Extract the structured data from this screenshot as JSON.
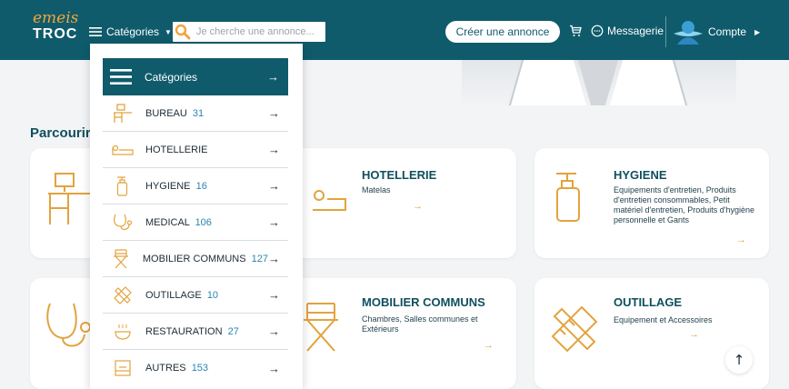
{
  "header": {
    "logo_top": "emeis",
    "logo_bottom": "TROC",
    "categories_label": "Catégories",
    "search_placeholder": "Je cherche une annonce...",
    "create_label": "Créer une annonce",
    "messages_label": "Messagerie",
    "account_label": "Compte"
  },
  "colors": {
    "primary": "#0f5b6b",
    "accent": "#e3a33d",
    "count": "#2a85b0"
  },
  "section_title": "Parcourir",
  "dropdown": {
    "header_label": "Catégories",
    "items": [
      {
        "name": "BUREAU",
        "count": "31",
        "icon": "desk-icon"
      },
      {
        "name": "HOTELLERIE",
        "count": "",
        "icon": "bed-icon"
      },
      {
        "name": "HYGIENE",
        "count": "16",
        "icon": "soap-bottle-icon"
      },
      {
        "name": "MEDICAL",
        "count": "106",
        "icon": "stethoscope-icon"
      },
      {
        "name": "MOBILIER COMMUNS",
        "count": "127",
        "icon": "chair-icon"
      },
      {
        "name": "OUTILLAGE",
        "count": "10",
        "icon": "tools-icon"
      },
      {
        "name": "RESTAURATION",
        "count": "27",
        "icon": "dish-icon"
      },
      {
        "name": "AUTRES",
        "count": "153",
        "icon": "box-icon"
      }
    ]
  },
  "cards": {
    "hotellerie": {
      "title": "HOTELLERIE",
      "desc": "Matelas"
    },
    "hygiene": {
      "title": "HYGIENE",
      "desc": "Equipements d'entretien, Produits d'entretien consommables, Petit matériel d'entretien, Produits d'hygiène personnelle et Gants"
    },
    "mobilier": {
      "title": "MOBILIER COMMUNS",
      "desc": "Chambres, Salles communes et Extérieurs"
    },
    "outillage": {
      "title": "OUTILLAGE",
      "desc": "Equipement et Accessoires"
    }
  },
  "arrow_glyph": "→",
  "scroll_top_glyph": "↑"
}
